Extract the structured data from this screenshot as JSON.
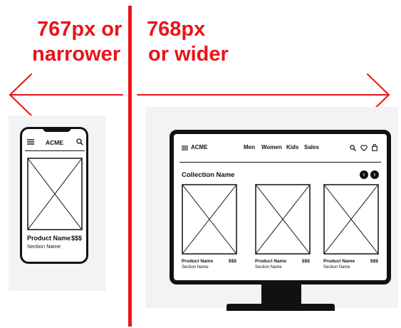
{
  "left_heading": {
    "line1": "767px or",
    "line2": "narrower"
  },
  "right_heading": {
    "line1": "768px",
    "line2": "or wider"
  },
  "colors": {
    "accent": "#e8141b",
    "frame": "#111111",
    "panel": "#f3f3f3"
  },
  "mobile": {
    "brand": "ACME",
    "product": {
      "name": "Product Name",
      "price": "$$$",
      "section": "Section Name"
    }
  },
  "desktop": {
    "brand": "ACME",
    "nav": [
      "Men",
      "Women",
      "Kids",
      "Sales"
    ],
    "collection_title": "Collection Name",
    "products": [
      {
        "name": "Product Name",
        "price": "$$$",
        "section": "Section Name"
      },
      {
        "name": "Product Name",
        "price": "$$$",
        "section": "Section Name"
      },
      {
        "name": "Product Name",
        "price": "$$$",
        "section": "Section Name"
      }
    ]
  },
  "icons": [
    "hamburger-menu-icon",
    "search-icon",
    "heart-icon",
    "shopping-bag-icon",
    "chevron-left-icon",
    "chevron-right-icon"
  ]
}
